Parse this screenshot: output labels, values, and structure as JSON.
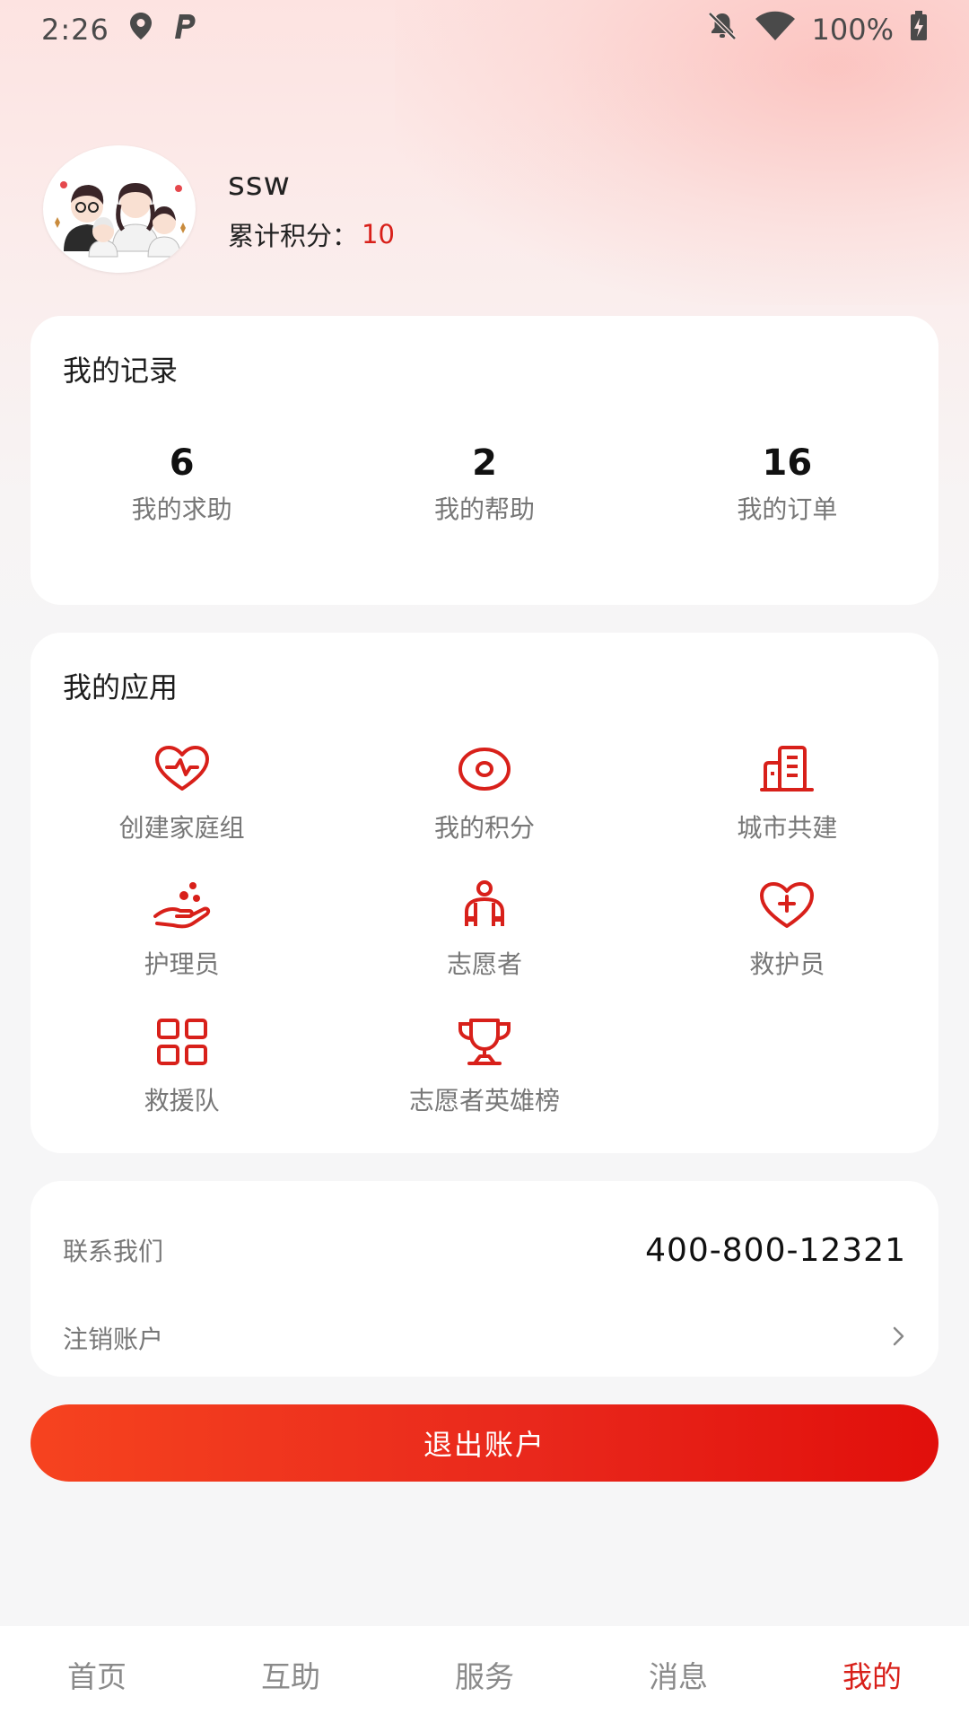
{
  "status_bar": {
    "time": "2:26",
    "battery": "100%",
    "icons": [
      "location-icon",
      "parking-icon",
      "notifications-off-icon",
      "wifi-icon",
      "battery-charging-icon"
    ]
  },
  "profile": {
    "username": "ssw",
    "points_label": "累计积分：",
    "points_value": "10"
  },
  "records": {
    "title": "我的记录",
    "stats": [
      {
        "value": "6",
        "label": "我的求助"
      },
      {
        "value": "2",
        "label": "我的帮助"
      },
      {
        "value": "16",
        "label": "我的订单"
      }
    ]
  },
  "apps": {
    "title": "我的应用",
    "items": [
      {
        "label": "创建家庭组",
        "icon": "heart-pulse-icon"
      },
      {
        "label": "我的积分",
        "icon": "target-icon"
      },
      {
        "label": "城市共建",
        "icon": "buildings-icon"
      },
      {
        "label": "护理员",
        "icon": "caring-hand-icon"
      },
      {
        "label": "志愿者",
        "icon": "volunteer-icon"
      },
      {
        "label": "救护员",
        "icon": "heart-plus-icon"
      },
      {
        "label": "救援队",
        "icon": "grid-icon"
      },
      {
        "label": "志愿者英雄榜",
        "icon": "trophy-icon"
      }
    ]
  },
  "contact": {
    "contact_label": "联系我们",
    "phone": "400-800-12321",
    "cancel_label": "注销账户"
  },
  "logout_label": "退出账户",
  "nav": {
    "items": [
      {
        "label": "首页",
        "active": false
      },
      {
        "label": "互助",
        "active": false
      },
      {
        "label": "服务",
        "active": false
      },
      {
        "label": "消息",
        "active": false
      },
      {
        "label": "我的",
        "active": true
      }
    ]
  },
  "colors": {
    "accent": "#d8201a",
    "button_gradient_start": "#f6431f",
    "button_gradient_end": "#e10f0b",
    "label_gray": "#777777"
  }
}
